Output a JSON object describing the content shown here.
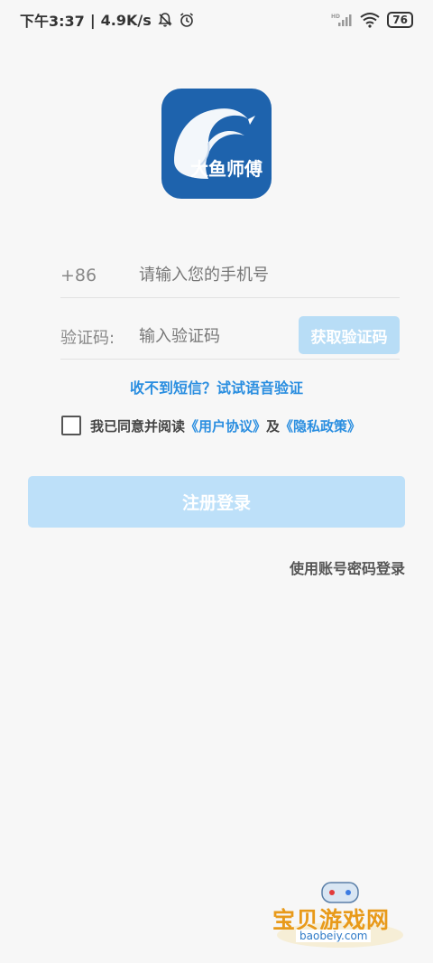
{
  "status_bar": {
    "time": "下午3:37",
    "speed": "4.9K/s",
    "network": "HD",
    "battery": "76"
  },
  "logo": {
    "text": "大鱼师傅",
    "brand_color": "#1e63ad"
  },
  "form": {
    "country_code": "+86",
    "phone_placeholder": "请输入您的手机号",
    "code_label": "验证码:",
    "code_placeholder": "输入验证码",
    "get_code_label": "获取验证码",
    "voice_link": "收不到短信？试试语音验证",
    "agree_prefix": "我已同意并阅读",
    "user_agreement": "《用户协议》",
    "and": "及",
    "privacy_policy": "《隐私政策》",
    "agree_checked": false,
    "register_label": "注册登录",
    "password_login_label": "使用账号密码登录"
  },
  "watermark": {
    "text": "宝贝游戏网",
    "url": "baobeiy.com"
  },
  "colors": {
    "accent": "#2a8ee0",
    "button_disabled": "#bde0f9"
  }
}
